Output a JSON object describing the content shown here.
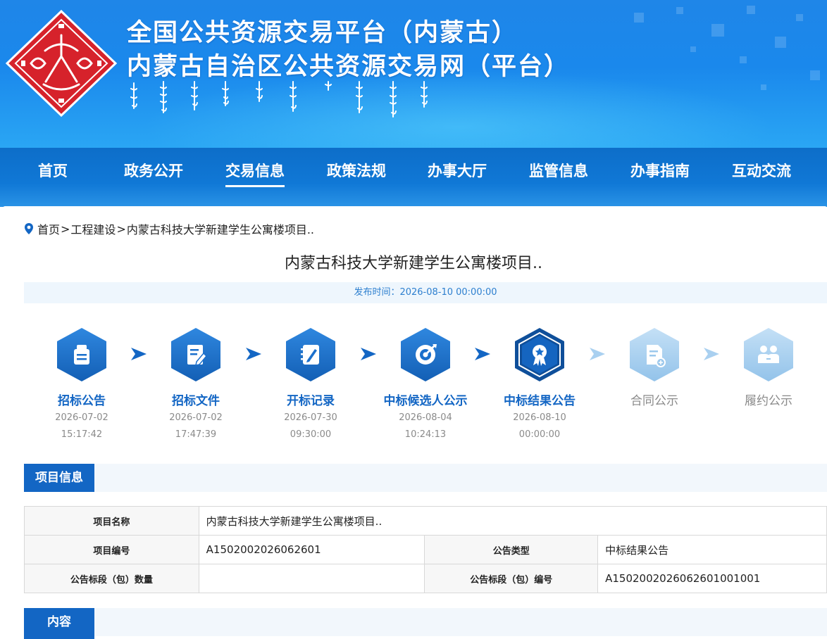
{
  "header": {
    "title_line1": "全国公共资源交易平台（内蒙古）",
    "title_line2": "内蒙古自治区公共资源交易网（平台）"
  },
  "nav": {
    "items": [
      {
        "label": "首页"
      },
      {
        "label": "政务公开"
      },
      {
        "label": "交易信息",
        "active": true
      },
      {
        "label": "政策法规"
      },
      {
        "label": "办事大厅"
      },
      {
        "label": "监管信息"
      },
      {
        "label": "办事指南"
      },
      {
        "label": "互动交流"
      }
    ]
  },
  "breadcrumb": {
    "home": "首页",
    "sep": ">",
    "category": "工程建设",
    "current": "内蒙古科技大学新建学生公寓楼项目.."
  },
  "page": {
    "title": "内蒙古科技大学新建学生公寓楼项目..",
    "publish_time": "发布时间：2026-08-10 00:00:00"
  },
  "steps": [
    {
      "label": "招标公告",
      "date": "2026-07-02",
      "time": "15:17:42",
      "icon": "notice-board-icon",
      "status": "done"
    },
    {
      "label": "招标文件",
      "date": "2026-07-02",
      "time": "17:47:39",
      "icon": "document-edit-icon",
      "status": "done"
    },
    {
      "label": "开标记录",
      "date": "2026-07-30",
      "time": "09:30:00",
      "icon": "notebook-pen-icon",
      "status": "done"
    },
    {
      "label": "中标候选人公示",
      "date": "2026-08-04",
      "time": "10:24:13",
      "icon": "target-icon",
      "status": "done"
    },
    {
      "label": "中标结果公告",
      "date": "2026-08-10",
      "time": "00:00:00",
      "icon": "award-medal-icon",
      "status": "current"
    },
    {
      "label": "合同公示",
      "date": "",
      "time": "",
      "icon": "contract-icon",
      "status": "pending"
    },
    {
      "label": "履约公示",
      "date": "",
      "time": "",
      "icon": "handshake-people-icon",
      "status": "pending"
    }
  ],
  "project_info": {
    "section_title": "项目信息",
    "name_label": "项目名称",
    "name_value": "内蒙古科技大学新建学生公寓楼项目..",
    "code_label": "项目编号",
    "code_value": "A1502002026062601",
    "type_label": "公告类型",
    "type_value": "中标结果公告",
    "section_count_label": "公告标段（包）数量",
    "section_count_value": "",
    "section_code_label": "公告标段（包）编号",
    "section_code_value": "A1502002026062601001001"
  },
  "content": {
    "section_title": "内容"
  },
  "colors": {
    "primary": "#1366c4",
    "header_blue": "#1a88ec",
    "nav_blue": "#0d6ec9",
    "logo_red": "#d6222b",
    "pending_icon": "#a9d0f0",
    "muted_text": "#8a8a8a"
  }
}
